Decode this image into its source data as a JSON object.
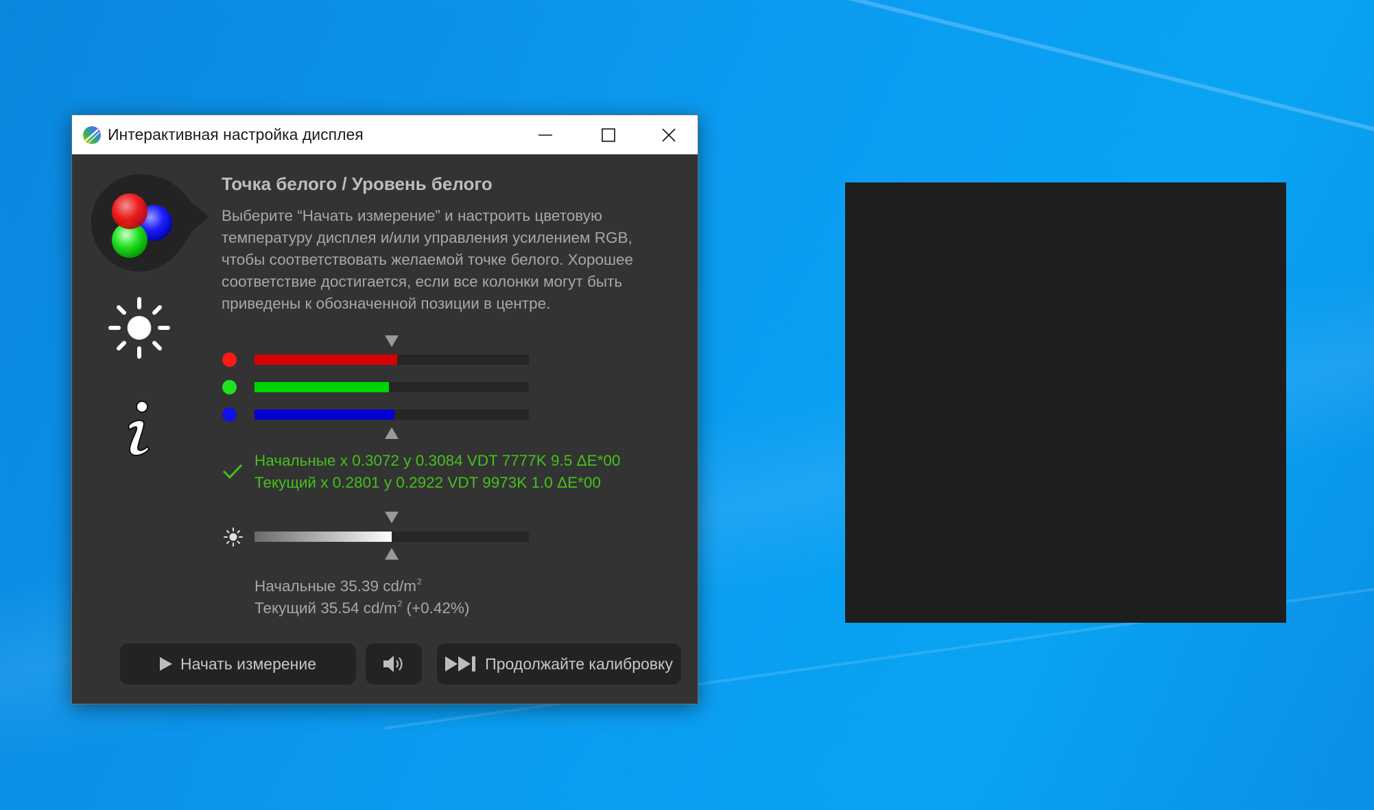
{
  "window": {
    "title": "Интерактивная настройка дисплея",
    "controls": [
      "minimize",
      "maximize",
      "close"
    ]
  },
  "sidebar": {
    "icons": [
      "rgb-circles-icon",
      "brightness-icon",
      "info-icon"
    ]
  },
  "content": {
    "heading": "Точка белого / Уровень белого",
    "description": "Выберите “Начать измерение” и настроить цветовую температуру дисплея и/или управления усилением RGB, чтобы соответствовать желаемой точке белого. Хорошее соответствие достигается, если все колонки могут быть приведены к обозначенной позиции в центре.",
    "rgb_bars": [
      {
        "channel": "red",
        "color": "#d60000",
        "dot_color": "#ff1a1a",
        "level": 0.52
      },
      {
        "channel": "green",
        "color": "#00d400",
        "dot_color": "#1fe21f",
        "level": 0.49
      },
      {
        "channel": "blue",
        "color": "#0000d0",
        "dot_color": "#1010e8",
        "level": 0.51
      }
    ],
    "white_point_status": {
      "initial": "Начальные x 0.3072 y 0.3084 VDT 7777K 9.5 ΔE*00",
      "current": "Текущий x 0.2801 y 0.2922 VDT 9973K 1.0 ΔE*00",
      "ok_color": "#44c21a"
    },
    "luminance_bar": {
      "level": 0.5
    },
    "luminance_status": {
      "initial_prefix": "Начальные 35.39 cd/m",
      "initial_sup": "2",
      "current_prefix": "Текущий 35.54 cd/m",
      "current_sup": "2",
      "current_suffix": " (+0.42%)"
    }
  },
  "buttons": {
    "start_measurement": "Начать измерение",
    "sound": "sound-icon",
    "continue_calibration": "Продолжайте калибровку"
  },
  "colors": {
    "desktop": "#0a9bf0",
    "window_bg": "#333333",
    "button_bg": "#232323",
    "measure_patch": "#1e1e1e"
  }
}
